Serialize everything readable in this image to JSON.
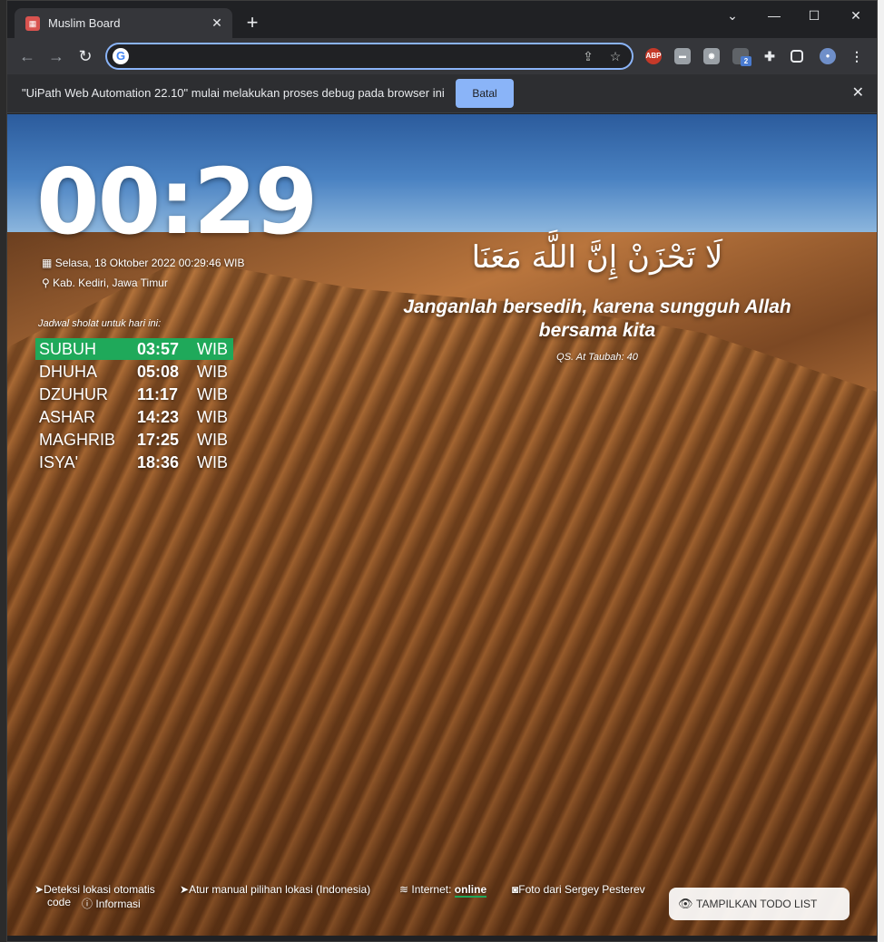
{
  "browser": {
    "tab_title": "Muslim Board",
    "tab_close": "✕",
    "new_tab": "+",
    "window_controls": [
      "⌄",
      "—",
      "☐",
      "✕"
    ],
    "address_value": "",
    "extensions": [
      "ABP",
      "2"
    ]
  },
  "infobar": {
    "message": "\"UiPath Web Automation 22.10\" mulai melakukan proses debug pada browser ini",
    "button": "Batal",
    "close": "✕"
  },
  "clock": {
    "time": "00:29",
    "date": "Selasa, 18 Oktober 2022 00:29:46 WIB",
    "location": "Kab. Kediri, Jawa Timur"
  },
  "schedule": {
    "title": "Jadwal sholat untuk hari ini:",
    "items": [
      {
        "name": "SUBUH",
        "time": "03:57",
        "zone": "WIB"
      },
      {
        "name": "DHUHA",
        "time": "05:08",
        "zone": "WIB"
      },
      {
        "name": "DZUHUR",
        "time": "11:17",
        "zone": "WIB"
      },
      {
        "name": "ASHAR",
        "time": "14:23",
        "zone": "WIB"
      },
      {
        "name": "MAGHRIB",
        "time": "17:25",
        "zone": "WIB"
      },
      {
        "name": "ISYA'",
        "time": "18:36",
        "zone": "WIB"
      }
    ]
  },
  "quote": {
    "arabic": "لَا تَحْزَنْ إِنَّ اللَّهَ مَعَنَا",
    "translation": "Janganlah bersedih, karena sungguh Allah bersama kita",
    "source": "QS. At Taubah: 40"
  },
  "footer": {
    "detect": "Deteksi lokasi otomatis",
    "manual": "Atur manual pilihan lokasi (Indonesia)",
    "internet_label": "Internet:",
    "internet_status": "online",
    "photo": "Foto dari Sergey Pesterev",
    "code": "code",
    "info": "Informasi"
  },
  "todo_button": "TAMPILKAN TODO LIST",
  "colors": {
    "active_prayer": "#1fa95a",
    "accent": "#8ab4f8"
  },
  "icons": [
    "calendar-icon",
    "map-marker-icon",
    "location-arrow-icon",
    "wifi-icon",
    "camera-icon",
    "info-icon",
    "eye-icon"
  ]
}
